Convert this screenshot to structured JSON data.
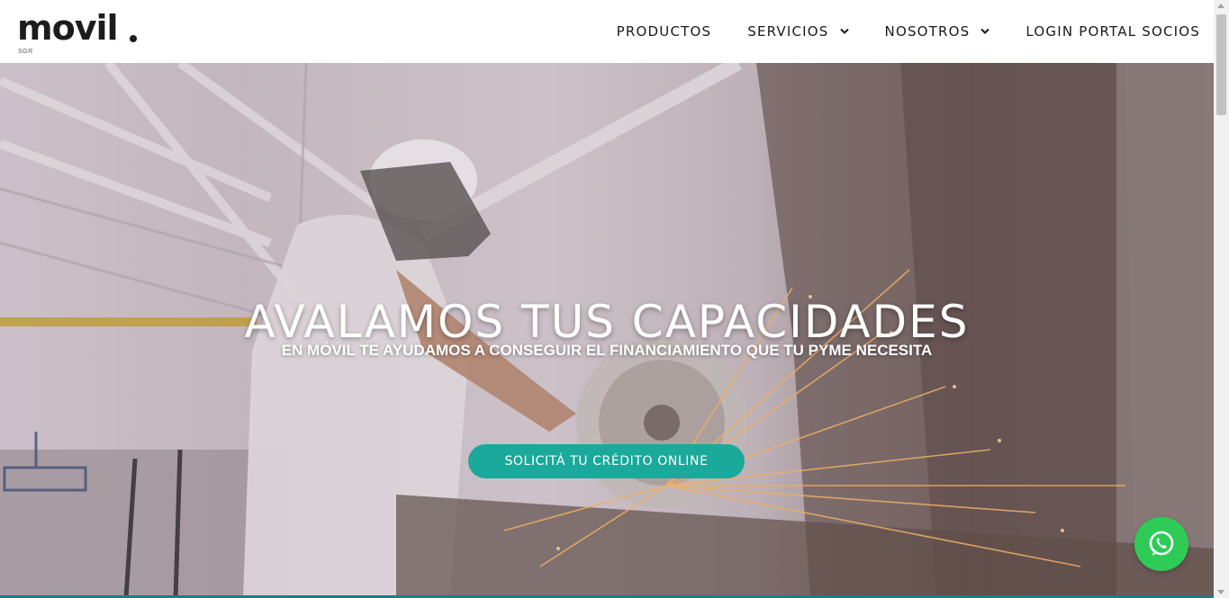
{
  "brand": {
    "name": "movil",
    "suffix": ".",
    "sub": "SGR"
  },
  "nav": {
    "items": [
      {
        "label": "PRODUCTOS",
        "has_dropdown": false
      },
      {
        "label": "SERVICIOS",
        "has_dropdown": true
      },
      {
        "label": "NOSOTROS",
        "has_dropdown": true
      },
      {
        "label": "LOGIN PORTAL SOCIOS",
        "has_dropdown": false
      }
    ]
  },
  "hero": {
    "title": "AVALAMOS TUS CAPACIDADES",
    "subtitle": "EN MÓVIL TE AYUDAMOS A CONSEGUIR EL FINANCIAMIENTO QUE TU PYME NECESITA",
    "cta_label": "SOLICITÁ TU CRÉDITO ONLINE"
  },
  "icons": {
    "chevron": "chevron-down-icon",
    "whatsapp": "whatsapp-icon"
  },
  "colors": {
    "accent": "#1aa99a",
    "whatsapp": "#2ecc57",
    "text_dark": "#1a1a1a",
    "logo_accent": "#0a8f6a"
  }
}
